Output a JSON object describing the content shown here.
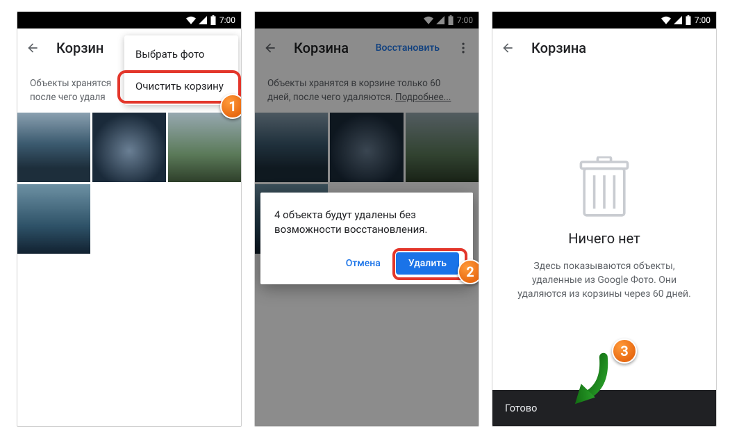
{
  "statusbar": {
    "time": "7:00"
  },
  "screen1": {
    "title": "Корзин",
    "menu": {
      "select": "Выбрать фото",
      "empty": "Очистить корзину"
    },
    "info": "Объекты хранятся\nпосле чего удаля"
  },
  "screen2": {
    "title": "Корзина",
    "restore": "Восстановить",
    "info_a": "Объекты хранятся в корзине только 60 дней, после чего удаляются. ",
    "info_link": "Подробнее...",
    "dialog": {
      "msg": "4 объекта будут удалены без возможности восстановления.",
      "cancel": "Отмена",
      "delete": "Удалить"
    }
  },
  "screen3": {
    "title": "Корзина",
    "empty_title": "Ничего нет",
    "empty_sub": "Здесь показываются объекты, удаленные из Google Фото. Они удаляются из корзины через 60 дней.",
    "snackbar": "Готово"
  },
  "badges": {
    "b1": "1",
    "b2": "2",
    "b3": "3"
  }
}
